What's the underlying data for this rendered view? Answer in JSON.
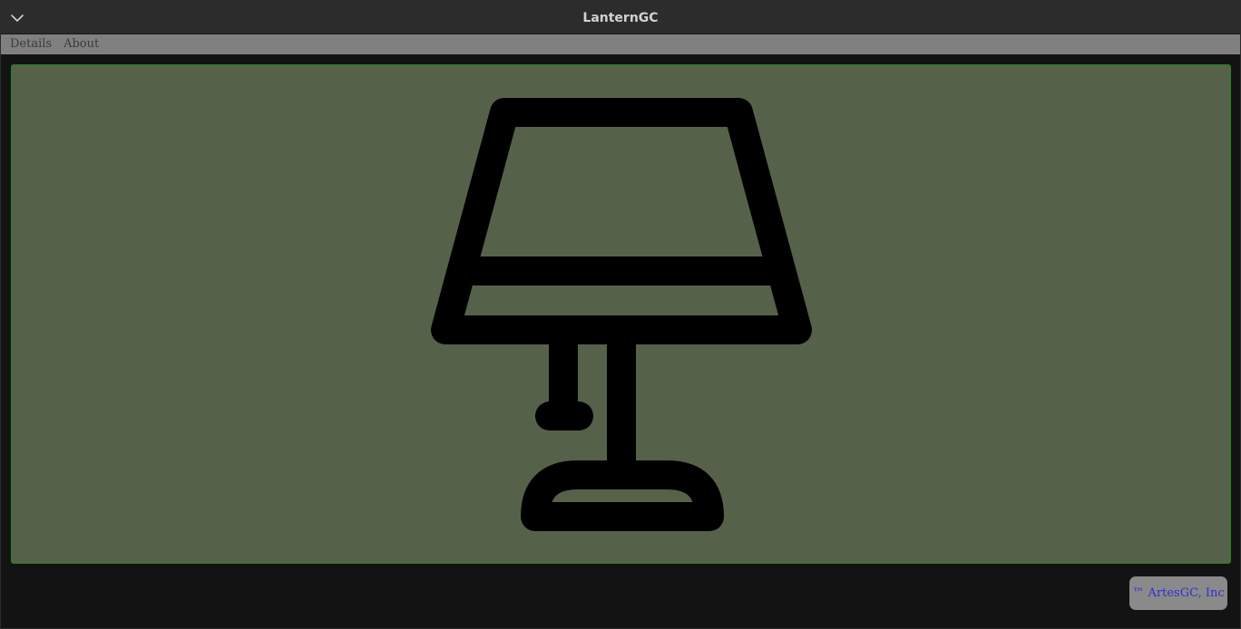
{
  "window": {
    "title": "LanternGC"
  },
  "titlebar": {
    "menu_icon": "chevron-down-icon"
  },
  "menubar": {
    "items": [
      {
        "label": "Details"
      },
      {
        "label": "About"
      }
    ]
  },
  "main": {
    "illustration": "table-lamp-icon",
    "panel_color": "#56614a",
    "panel_border_color": "#1f8a1f"
  },
  "footer": {
    "brand_label": "™ ArtesGC, Inc"
  }
}
